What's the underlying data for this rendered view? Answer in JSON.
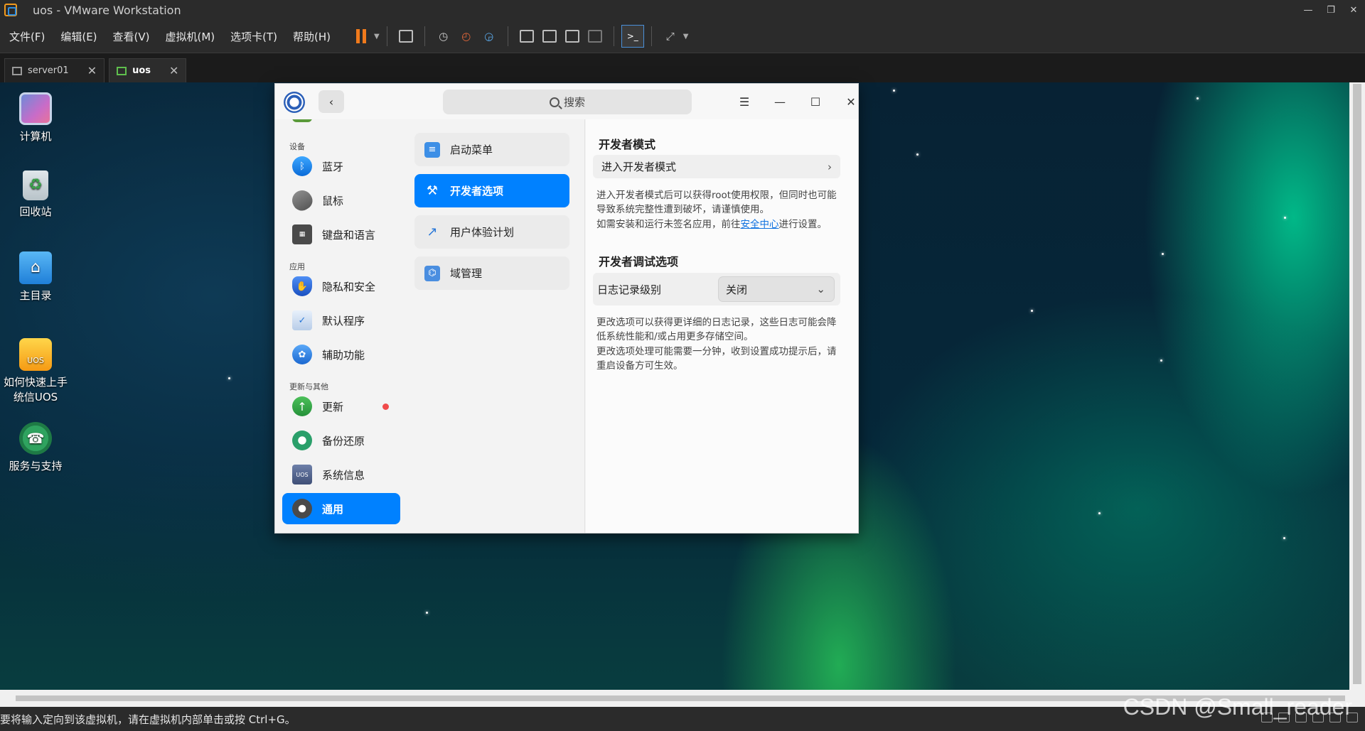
{
  "vmware": {
    "title": "uos - VMware Workstation",
    "window_controls": {
      "minimize": "—",
      "restore": "❐",
      "close": "✕"
    },
    "menu": [
      "文件(F)",
      "编辑(E)",
      "查看(V)",
      "虚拟机(M)",
      "选项卡(T)",
      "帮助(H)"
    ],
    "tabs": [
      {
        "label": "server01",
        "close": "✕",
        "active": false
      },
      {
        "label": "uos",
        "close": "✕",
        "active": true
      }
    ],
    "status_text": "要将输入定向到该虚拟机，请在虚拟机内部单击或按 Ctrl+G。",
    "watermark": "CSDN @Small_reader"
  },
  "desktop": {
    "icons": [
      {
        "label": "计算机",
        "icon": "computer-icon"
      },
      {
        "label": "回收站",
        "icon": "trash-icon"
      },
      {
        "label": "主目录",
        "icon": "home-folder-icon"
      },
      {
        "label": "如何快速上手统信UOS",
        "icon": "uos-guide-icon"
      },
      {
        "label": "服务与支持",
        "icon": "support-icon"
      }
    ]
  },
  "control_center": {
    "search_placeholder": "搜索",
    "back_icon": "‹",
    "menu_icon": "☰",
    "minimize_icon": "—",
    "maximize_icon": "☐",
    "close_icon": "✕",
    "sidebar": {
      "sections": {
        "devices": "设备",
        "apps": "应用",
        "update_other": "更新与其他"
      },
      "items": [
        {
          "label": "蓝牙",
          "icon": "bluetooth-icon"
        },
        {
          "label": "鼠标",
          "icon": "mouse-icon"
        },
        {
          "label": "键盘和语言",
          "icon": "keyboard-icon"
        },
        {
          "label": "隐私和安全",
          "icon": "privacy-shield-icon"
        },
        {
          "label": "默认程序",
          "icon": "default-apps-icon"
        },
        {
          "label": "辅助功能",
          "icon": "accessibility-icon"
        },
        {
          "label": "更新",
          "icon": "update-icon",
          "badge": true
        },
        {
          "label": "备份还原",
          "icon": "backup-icon"
        },
        {
          "label": "系统信息",
          "icon": "system-info-icon"
        },
        {
          "label": "通用",
          "icon": "general-icon",
          "active": true
        }
      ]
    },
    "middle": {
      "items": [
        {
          "label": "启动菜单",
          "icon": "boot-menu-icon"
        },
        {
          "label": "开发者选项",
          "icon": "developer-tools-icon",
          "active": true
        },
        {
          "label": "用户体验计划",
          "icon": "user-experience-icon"
        },
        {
          "label": "域管理",
          "icon": "domain-management-icon"
        }
      ]
    },
    "content": {
      "dev_mode_title": "开发者模式",
      "enter_dev_mode": "进入开发者模式",
      "dev_mode_desc": "进入开发者模式后可以获得root使用权限，但同时也可能导致系统完整性遭到破坏，请谨慎使用。",
      "unsigned_prefix": "如需安装和运行未签名应用，前往",
      "security_center_link": "安全中心",
      "unsigned_suffix": "进行设置。",
      "debug_title": "开发者调试选项",
      "log_level_label": "日志记录级别",
      "log_level_value": "关闭",
      "log_desc_1": "更改选项可以获得更详细的日志记录，这些日志可能会降低系统性能和/或占用更多存储空间。",
      "log_desc_2": "更改选项处理可能需要一分钟，收到设置成功提示后，请重启设备方可生效。"
    }
  }
}
